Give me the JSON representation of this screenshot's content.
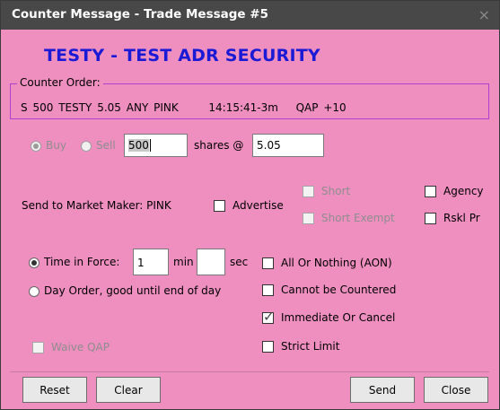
{
  "window": {
    "title": "Counter Message - Trade Message #5",
    "close_label": "×"
  },
  "security": {
    "title": "TESTY - TEST ADR SECURITY"
  },
  "counter_order": {
    "legend": "Counter Order:",
    "side": "S",
    "quantity": "500",
    "symbol": "TESTY",
    "price": "5.05",
    "condition": "ANY",
    "mm": "PINK",
    "time": "14:15:41-3m",
    "qap": "QAP +10"
  },
  "side": {
    "buy_label": "Buy",
    "sell_label": "Sell",
    "selected": "Buy"
  },
  "shares": {
    "value": "500",
    "label": "shares @"
  },
  "price": {
    "value": "5.05"
  },
  "market_maker": {
    "label": "Send to Market Maker: PINK"
  },
  "options": {
    "advertise": "Advertise",
    "short": "Short",
    "short_exempt": "Short Exempt",
    "agency": "Agency",
    "rskl_pr": "Rskl Pr"
  },
  "time_in_force": {
    "label": "Time in Force:",
    "min_value": "1",
    "min_label": "min",
    "sec_value": "",
    "sec_label": "sec",
    "day_order_label": "Day Order, good until end of day",
    "selected": "Time in Force"
  },
  "conditions": {
    "aon": "All Or Nothing (AON)",
    "cannot_counter": "Cannot be Countered",
    "ioc": "Immediate Or Cancel",
    "ioc_checked": true,
    "strict_limit": "Strict Limit"
  },
  "waive_qap": {
    "label": "Waive QAP"
  },
  "buttons": {
    "reset": "Reset",
    "clear": "Clear",
    "send": "Send",
    "close": "Close"
  }
}
